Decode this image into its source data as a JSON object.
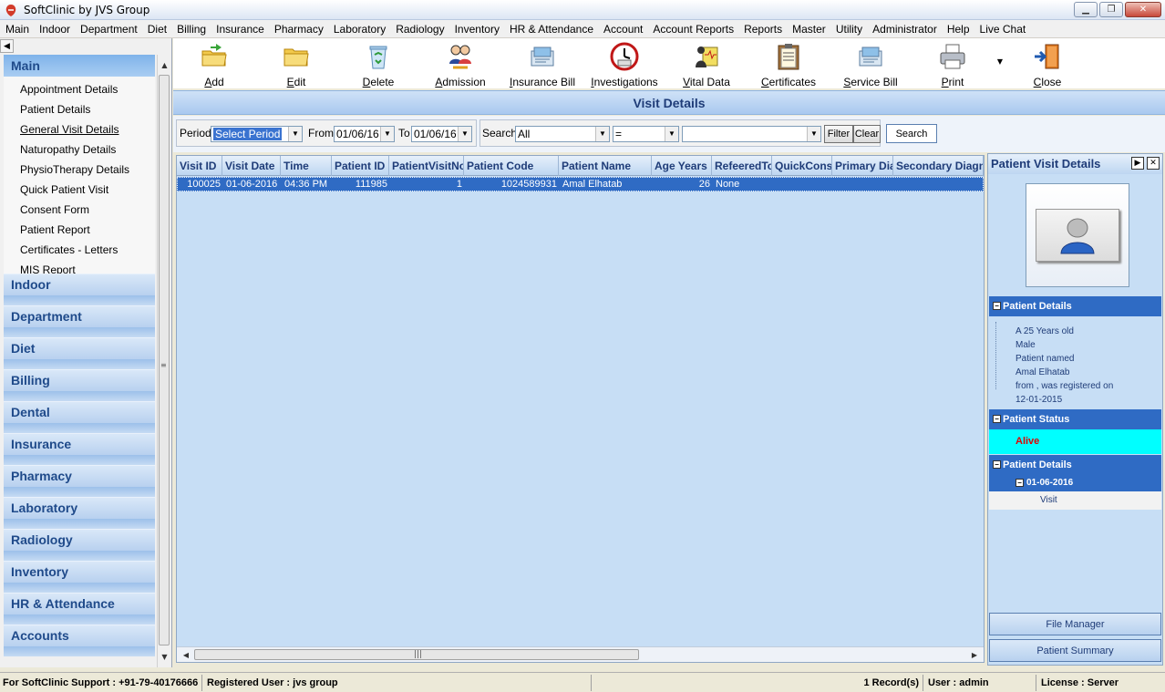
{
  "window": {
    "title": "SoftClinic by JVS Group"
  },
  "menu": [
    "Main",
    "Indoor",
    "Department",
    "Diet",
    "Billing",
    "Insurance",
    "Pharmacy",
    "Laboratory",
    "Radiology",
    "Inventory",
    "HR & Attendance",
    "Account",
    "Account Reports",
    "Reports",
    "Master",
    "Utility",
    "Administrator",
    "Help",
    "Live Chat"
  ],
  "sidebar": {
    "main_label": "Main",
    "main_items": [
      {
        "label": "Appointment Details",
        "active": false
      },
      {
        "label": "Patient Details",
        "active": false
      },
      {
        "label": "General Visit Details",
        "active": true
      },
      {
        "label": "Naturopathy Details",
        "active": false
      },
      {
        "label": "PhysioTherapy Details",
        "active": false
      },
      {
        "label": "Quick Patient Visit",
        "active": false
      },
      {
        "label": "Consent Form",
        "active": false
      },
      {
        "label": "Patient Report",
        "active": false
      },
      {
        "label": "Certificates - Letters",
        "active": false
      },
      {
        "label": "MIS Report",
        "active": false
      }
    ],
    "sections": [
      "Indoor",
      "Department",
      "Diet",
      "Billing",
      "Dental",
      "Insurance",
      "Pharmacy",
      "Laboratory",
      "Radiology",
      "Inventory",
      "HR & Attendance",
      "Accounts"
    ]
  },
  "toolbar": {
    "buttons": [
      {
        "label": "Add",
        "icon": "folder-add-icon"
      },
      {
        "label": "Edit",
        "icon": "folder-edit-icon"
      },
      {
        "label": "Delete",
        "icon": "recycle-bin-icon"
      },
      {
        "label": "Admission",
        "icon": "admission-people-icon"
      },
      {
        "label": "Insurance Bill",
        "icon": "insurance-bill-icon"
      },
      {
        "label": "Investigations",
        "icon": "clock-icon"
      },
      {
        "label": "Vital Data",
        "icon": "vital-data-icon"
      },
      {
        "label": "Certificates",
        "icon": "clipboard-icon"
      },
      {
        "label": "Service Bill",
        "icon": "service-bill-icon"
      },
      {
        "label": "Print",
        "icon": "printer-icon"
      },
      {
        "label": "Close",
        "icon": "exit-door-icon"
      }
    ]
  },
  "page": {
    "title": "Visit Details"
  },
  "filter": {
    "period_label": "Period",
    "period_value": "Select Period",
    "from_label": "From",
    "from_value": "01/06/16",
    "to_label": "To",
    "to_value": "01/06/16",
    "search_label": "Search",
    "search_field": "All",
    "operator": "=",
    "search_text": "",
    "filter_btn": "Filter",
    "clear_btn": "Clear",
    "search_btn": "Search"
  },
  "grid": {
    "columns": [
      "Visit ID",
      "Visit Date",
      "Time",
      "Patient ID",
      "PatientVisitNo",
      "Patient Code",
      "Patient Name",
      "Age Years",
      "RefeeredTo",
      "QuickCons",
      "Primary Dia",
      "Secondary Diagnosis"
    ],
    "rows": [
      [
        "100025",
        "01-06-2016",
        "04:36 PM",
        "111985",
        "1",
        "1024589931",
        "Amal Elhatab",
        "26",
        "None",
        "",
        "",
        ""
      ]
    ]
  },
  "right_panel": {
    "title": "Patient Visit Details",
    "details_header": "Patient Details",
    "details_lines": [
      "A 25 Years old",
      "Male",
      "Patient named",
      "Amal Elhatab",
      " from , was registered on",
      "12-01-2015"
    ],
    "status_header": "Patient Status",
    "status_value": "Alive",
    "history_header": "Patient Details",
    "history_date": "01-06-2016",
    "history_item": "Visit",
    "file_manager_btn": "File Manager",
    "summary_btn": "Patient Summary"
  },
  "statusbar": {
    "support": "For SoftClinic Support : +91-79-40176666",
    "registered": "Registered User : jvs group",
    "records": "1 Record(s)",
    "user": "User : admin",
    "license": "License : Server"
  },
  "colors": {
    "accent": "#2f6bc4",
    "status_alive_bg": "#00ffff",
    "status_alive_text": "#e00000"
  }
}
